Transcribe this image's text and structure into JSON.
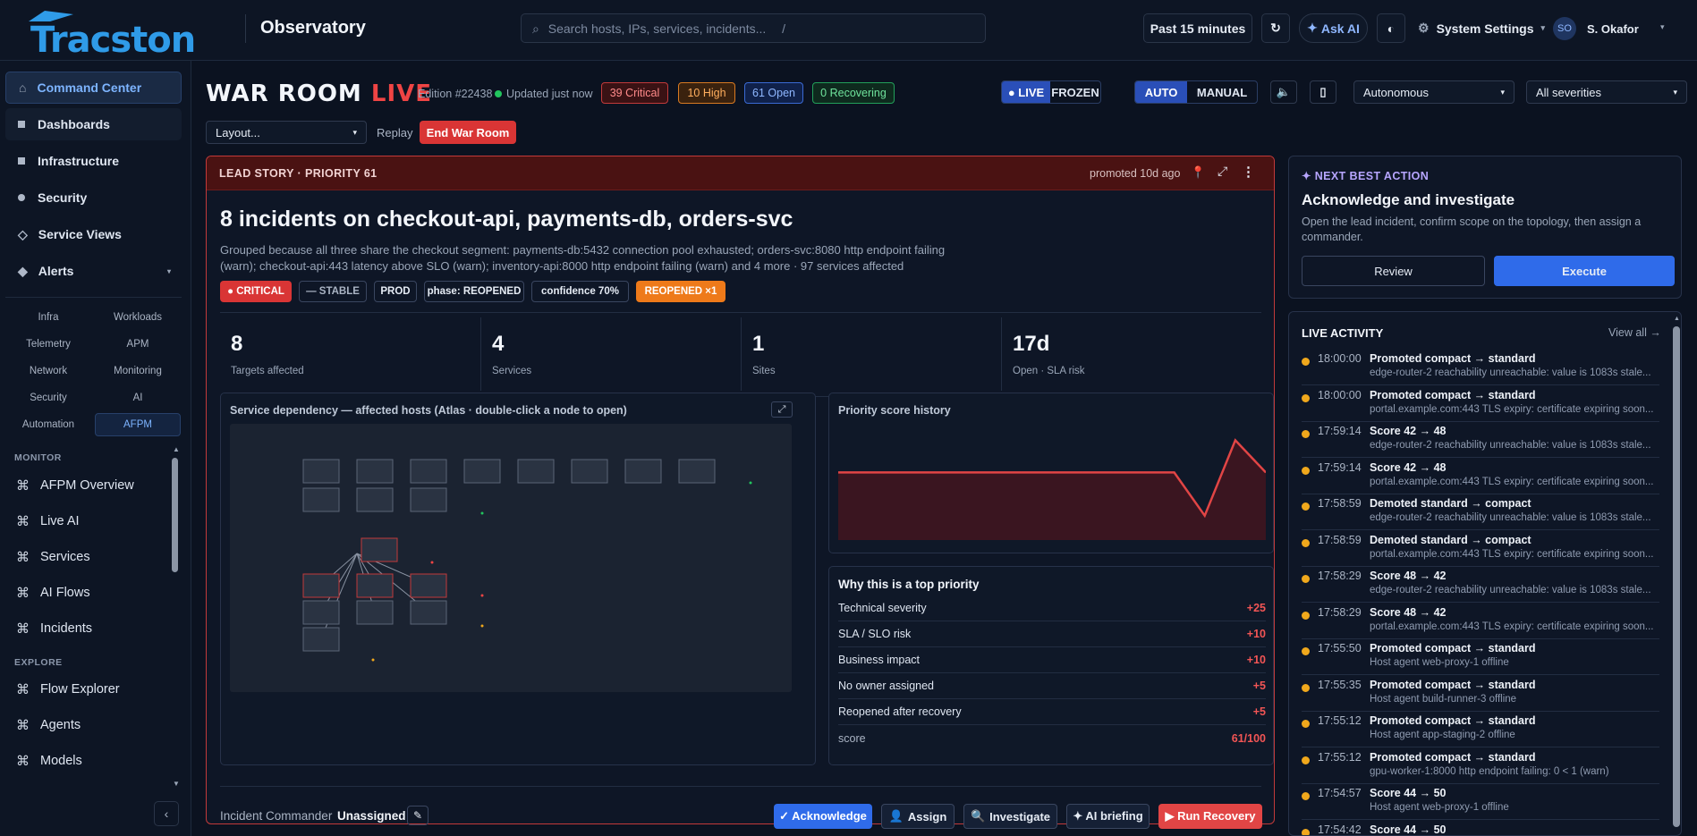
{
  "app": {
    "brand": "Tracston",
    "title": "Observatory"
  },
  "search": {
    "placeholder": "Search hosts, IPs, services, incidents...",
    "shortcut": "/"
  },
  "topbar": {
    "time_range": "Past 15 minutes",
    "refresh_icon": "refresh-icon",
    "ask_ai": "Ask AI",
    "theme_icon": "theme-toggle-icon",
    "settings": "System Settings",
    "user_initials": "SO",
    "user_name": "S. Okafor"
  },
  "sidebar": {
    "items": [
      {
        "label": "Command Center",
        "active": true
      },
      {
        "label": "Dashboards"
      },
      {
        "label": "Infrastructure"
      },
      {
        "label": "Security"
      },
      {
        "label": "Service Views"
      },
      {
        "label": "Alerts"
      }
    ],
    "subnav": [
      "Infra",
      "Workloads",
      "Telemetry",
      "APM",
      "Network",
      "Monitoring",
      "Security",
      "AI",
      "Automation",
      "AFPM"
    ],
    "monitor_label": "MONITOR",
    "monitor": [
      "AFPM Overview",
      "Live AI",
      "Services",
      "AI Flows",
      "Incidents"
    ],
    "explore_label": "EXPLORE",
    "explore": [
      "Flow Explorer",
      "Agents",
      "Models"
    ]
  },
  "warroom": {
    "title": "WAR ROOM",
    "live": "LIVE",
    "edition": "Edition #22438",
    "updated": "Updated just now",
    "pills": [
      "39 Critical",
      "10 High",
      "61 Open",
      "0 Recovering"
    ],
    "mode_live": "● LIVE",
    "mode_frozen": "FROZEN",
    "auto": "AUTO",
    "manual": "MANUAL",
    "autonomy": "Autonomous",
    "severity": "All severities",
    "layout": "Layout...",
    "replay": "Replay",
    "end": "End War Room"
  },
  "lead": {
    "header": "LEAD STORY · PRIORITY 61",
    "promoted": "promoted 10d ago",
    "title": "8 incidents on checkout-api, payments-db, orders-svc",
    "desc1": "Grouped because all three share the checkout segment: payments-db:5432 connection pool exhausted; orders-svc:8080 http endpoint failing",
    "desc2": "(warn); checkout-api:443 latency above SLO (warn); inventory-api:8000 http endpoint failing (warn) and 4 more · 97 services affected",
    "tags": [
      "● CRITICAL",
      "— STABLE",
      "PROD",
      "phase: REOPENED",
      "confidence 70%",
      "REOPENED ×1"
    ],
    "stats": [
      {
        "n": "8",
        "l": "Targets affected"
      },
      {
        "n": "4",
        "l": "Services"
      },
      {
        "n": "1",
        "l": "Sites"
      },
      {
        "n": "17d",
        "l": "Open · SLA risk"
      }
    ],
    "dependency_title": "Service dependency — affected hosts (Atlas · double-click a node to open)",
    "history_title": "Priority score history",
    "why_title": "Why this is a top priority",
    "why": [
      {
        "k": "Technical severity",
        "v": "+25"
      },
      {
        "k": "SLA / SLO risk",
        "v": "+10"
      },
      {
        "k": "Business impact",
        "v": "+10"
      },
      {
        "k": "No owner assigned",
        "v": "+5"
      },
      {
        "k": "Reopened after recovery",
        "v": "+5"
      },
      {
        "k": "score",
        "v": "61/100"
      }
    ],
    "commander_label": "Incident Commander",
    "commander_value": "Unassigned",
    "actions": [
      "✓ Acknowledge",
      "Assign",
      "Investigate",
      "✦ AI briefing",
      "▶ Run Recovery"
    ]
  },
  "chart_data": {
    "type": "line",
    "title": "Priority score history",
    "series": [
      {
        "values": [
          61,
          61,
          61,
          61,
          61,
          61,
          61,
          61,
          61,
          61,
          61,
          61,
          22,
          90,
          61
        ]
      }
    ],
    "color": "#e14545"
  },
  "next_action": {
    "label": "✦ NEXT BEST ACTION",
    "title": "Acknowledge and investigate",
    "desc": "Open the lead incident, confirm scope on the topology, then assign a commander.",
    "review": "Review",
    "execute": "Execute"
  },
  "activity": {
    "title": "LIVE ACTIVITY",
    "view_all": "View all →",
    "items": [
      {
        "t": "18:00:00",
        "h": "Promoted compact → standard",
        "d": "edge-router-2 reachability unreachable: value is 1083s stale..."
      },
      {
        "t": "18:00:00",
        "h": "Promoted compact → standard",
        "d": "portal.example.com:443 TLS expiry: certificate expiring soon..."
      },
      {
        "t": "17:59:14",
        "h": "Score 42 → 48",
        "d": "edge-router-2 reachability unreachable: value is 1083s stale..."
      },
      {
        "t": "17:59:14",
        "h": "Score 42 → 48",
        "d": "portal.example.com:443 TLS expiry: certificate expiring soon..."
      },
      {
        "t": "17:58:59",
        "h": "Demoted standard → compact",
        "d": "edge-router-2 reachability unreachable: value is 1083s stale..."
      },
      {
        "t": "17:58:59",
        "h": "Demoted standard → compact",
        "d": "portal.example.com:443 TLS expiry: certificate expiring soon..."
      },
      {
        "t": "17:58:29",
        "h": "Score 48 → 42",
        "d": "edge-router-2 reachability unreachable: value is 1083s stale..."
      },
      {
        "t": "17:58:29",
        "h": "Score 48 → 42",
        "d": "portal.example.com:443 TLS expiry: certificate expiring soon..."
      },
      {
        "t": "17:55:50",
        "h": "Promoted compact → standard",
        "d": "Host agent web-proxy-1 offline"
      },
      {
        "t": "17:55:35",
        "h": "Promoted compact → standard",
        "d": "Host agent build-runner-3 offline"
      },
      {
        "t": "17:55:12",
        "h": "Promoted compact → standard",
        "d": "Host agent app-staging-2 offline"
      },
      {
        "t": "17:55:12",
        "h": "Promoted compact → standard",
        "d": "gpu-worker-1:8000 http endpoint failing: 0 < 1 (warn)"
      },
      {
        "t": "17:54:57",
        "h": "Score 44 → 50",
        "d": "Host agent web-proxy-1 offline"
      },
      {
        "t": "17:54:42",
        "h": "Score 44 → 50",
        "d": ""
      }
    ]
  },
  "colors": {
    "accent": "#2f6bea",
    "critical": "#e14545",
    "high": "#f27a1a",
    "open": "#4a86ff",
    "recovering": "#22c55e"
  }
}
